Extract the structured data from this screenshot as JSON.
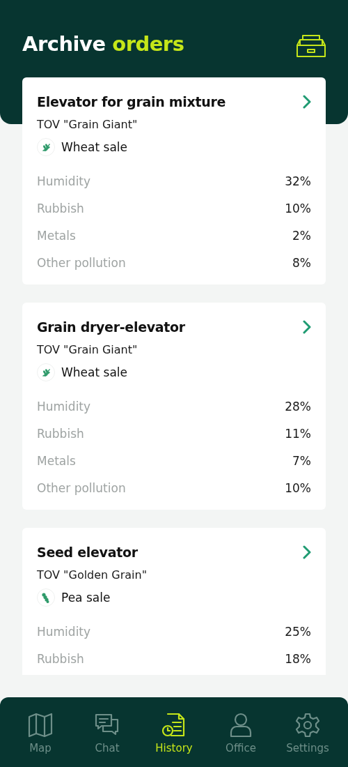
{
  "header": {
    "title": "Archive",
    "title_accent": "orders"
  },
  "orders": [
    {
      "name": "Elevator for grain mixture",
      "company": "TOV \"Grain Giant\"",
      "sale": {
        "kind": "wheat",
        "label": "Wheat sale"
      },
      "params": [
        {
          "label": "Humidity",
          "value": "32%"
        },
        {
          "label": "Rubbish",
          "value": "10%"
        },
        {
          "label": "Metals",
          "value": "2%"
        },
        {
          "label": "Other pollution",
          "value": "8%"
        }
      ]
    },
    {
      "name": "Grain dryer-elevator",
      "company": "TOV \"Grain Giant\"",
      "sale": {
        "kind": "wheat",
        "label": "Wheat sale"
      },
      "params": [
        {
          "label": "Humidity",
          "value": "28%"
        },
        {
          "label": "Rubbish",
          "value": "11%"
        },
        {
          "label": "Metals",
          "value": "7%"
        },
        {
          "label": "Other pollution",
          "value": "10%"
        }
      ]
    },
    {
      "name": "Seed elevator",
      "company": "TOV \"Golden Grain\"",
      "sale": {
        "kind": "pea",
        "label": "Pea sale"
      },
      "params": [
        {
          "label": "Humidity",
          "value": "25%"
        },
        {
          "label": "Rubbish",
          "value": "18%"
        }
      ]
    }
  ],
  "nav": [
    {
      "kind": "map",
      "label": "Map",
      "selected": false
    },
    {
      "kind": "chat",
      "label": "Chat",
      "selected": false
    },
    {
      "kind": "history",
      "label": "History",
      "selected": true
    },
    {
      "kind": "office",
      "label": "Office",
      "selected": false
    },
    {
      "kind": "settings",
      "label": "Settings",
      "selected": false
    }
  ]
}
